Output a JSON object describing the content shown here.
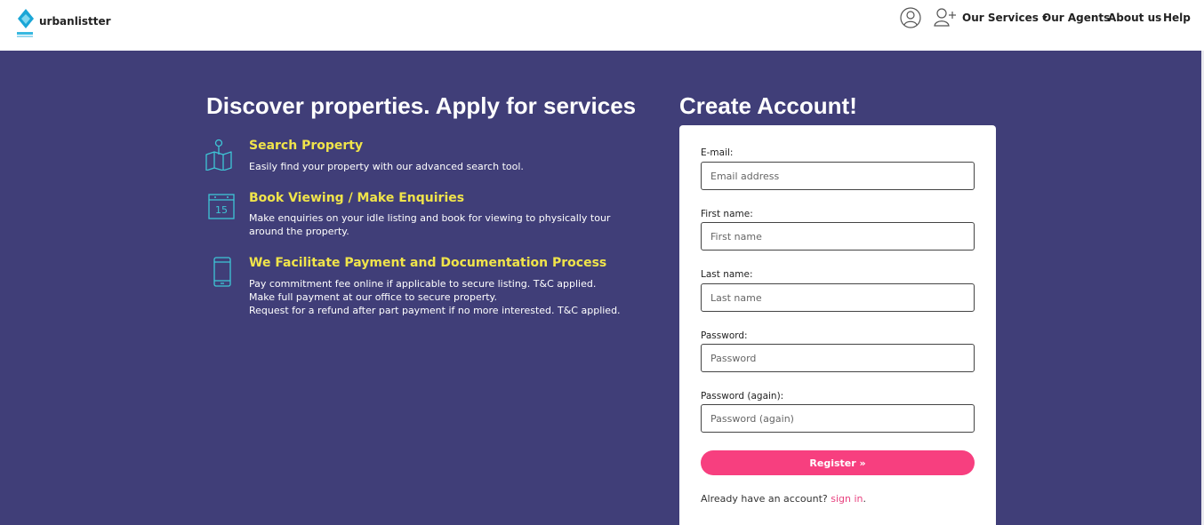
{
  "brand": {
    "name": "urbanlistter",
    "logo_icon": "diamond-logo-icon"
  },
  "nav": {
    "account_icon": "user-circle-icon",
    "add_user_icon": "user-plus-icon",
    "our_services": "Our Services",
    "our_agents": "Our Agents",
    "about_us": "About us",
    "help": "Help"
  },
  "hero": {
    "title": "Discover properties. Apply for services",
    "features": [
      {
        "icon": "map-pin-icon",
        "title": "Search Property",
        "lines": [
          "Easily find your property with our advanced search tool."
        ]
      },
      {
        "icon": "calendar-icon",
        "icon_text": "15",
        "title": "Book Viewing / Make Enquiries",
        "lines": [
          "Make enquiries on your idle listing and book for viewing to physically tour around the property."
        ]
      },
      {
        "icon": "mobile-phone-icon",
        "title": "We Facilitate Payment and Documentation Process",
        "lines": [
          "Pay commitment fee online if applicable to secure listing. T&C applied.",
          "Make full payment at our office to secure property.",
          "Request for a refund after part payment if no more interested. T&C applied."
        ]
      }
    ]
  },
  "register": {
    "title": "Create Account!",
    "fields": [
      {
        "label": "E-mail:",
        "placeholder": "Email address",
        "value": ""
      },
      {
        "label": "First name:",
        "placeholder": "First name",
        "value": ""
      },
      {
        "label": "Last name:",
        "placeholder": "Last name",
        "value": ""
      },
      {
        "label": "Password:",
        "placeholder": "Password",
        "value": ""
      },
      {
        "label": "Password (again):",
        "placeholder": "Password (again)",
        "value": ""
      }
    ],
    "button_label": "Register »",
    "signin_prefix": "Already have an account?",
    "signin_link": "sign in",
    "signin_suffix": "."
  },
  "colors": {
    "hero_bg": "#403e78",
    "accent_yellow": "#f0e44a",
    "button_pink": "#f73f7f",
    "link_pink": "#e8427f",
    "icon_cyan": "#3ec6d6"
  }
}
